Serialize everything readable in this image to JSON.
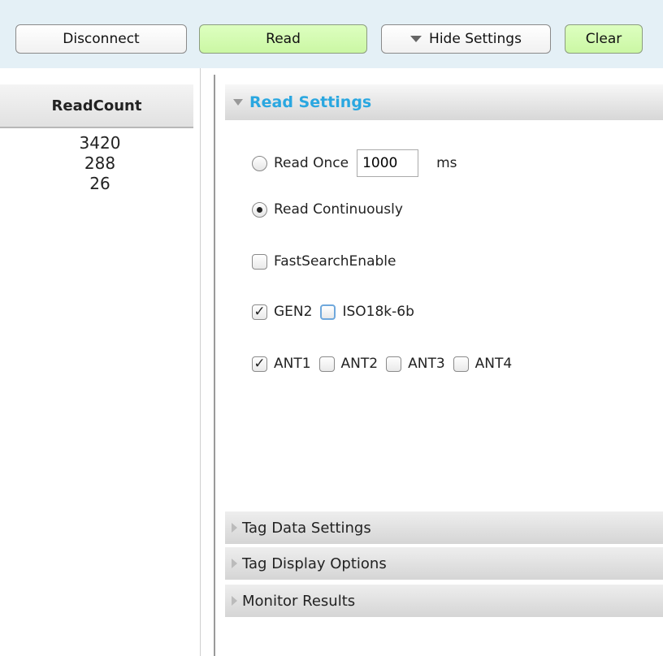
{
  "toolbar": {
    "disconnect_label": "Disconnect",
    "read_label": "Read",
    "hide_settings_label": "Hide Settings",
    "clear_label": "Clear"
  },
  "read_count": {
    "header": "ReadCount",
    "values": [
      "3420",
      "288",
      "26"
    ]
  },
  "read_settings": {
    "title": "Read Settings",
    "read_once_label": "Read Once",
    "read_once_value": "1000",
    "read_once_unit": "ms",
    "read_continuously_label": "Read Continuously",
    "mode_selected": "Read Continuously",
    "fast_search_label": "FastSearchEnable",
    "fast_search_checked": false,
    "protocols": [
      {
        "label": "GEN2",
        "checked": true
      },
      {
        "label": "ISO18k-6b",
        "checked": false
      }
    ],
    "antennas": [
      {
        "label": "ANT1",
        "checked": true
      },
      {
        "label": "ANT2",
        "checked": false
      },
      {
        "label": "ANT3",
        "checked": false
      },
      {
        "label": "ANT4",
        "checked": false
      }
    ]
  },
  "sections": {
    "tag_data": "Tag Data Settings",
    "tag_display": "Tag Display Options",
    "monitor_results": "Monitor Results"
  },
  "colors": {
    "toolbar_bg": "#e4f0f6",
    "green_button": "#cbf7a4",
    "section_title": "#2aa7e0"
  }
}
